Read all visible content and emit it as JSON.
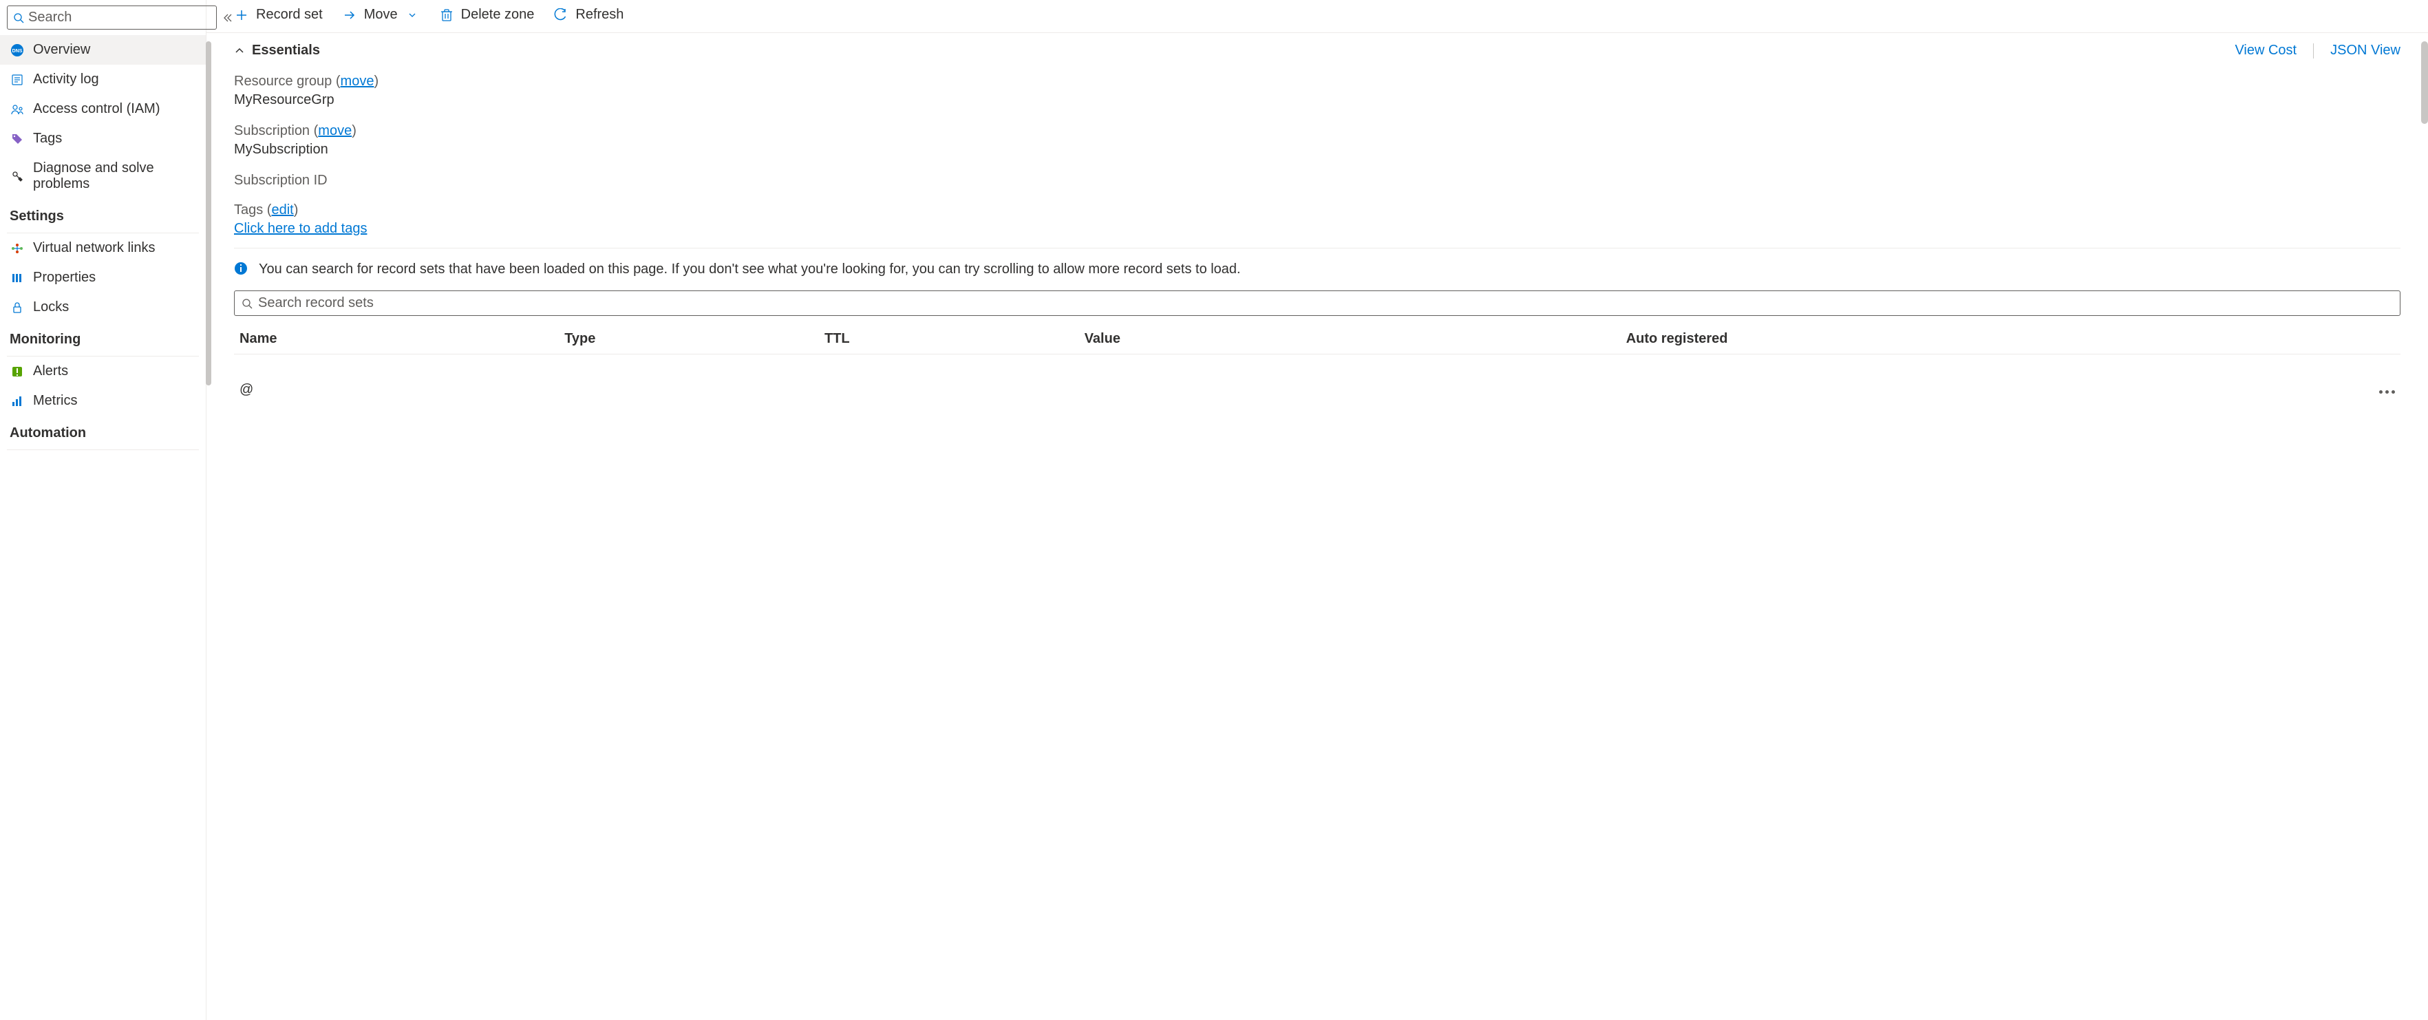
{
  "sidebar": {
    "search_placeholder": "Search",
    "items_top": [
      {
        "label": "Overview",
        "icon": "dns"
      },
      {
        "label": "Activity log",
        "icon": "log"
      },
      {
        "label": "Access control (IAM)",
        "icon": "iam"
      },
      {
        "label": "Tags",
        "icon": "tags"
      },
      {
        "label": "Diagnose and solve problems",
        "icon": "diagnose"
      }
    ],
    "section_settings": "Settings",
    "items_settings": [
      {
        "label": "Virtual network links",
        "icon": "vnet"
      },
      {
        "label": "Properties",
        "icon": "properties"
      },
      {
        "label": "Locks",
        "icon": "locks"
      }
    ],
    "section_monitoring": "Monitoring",
    "items_monitoring": [
      {
        "label": "Alerts",
        "icon": "alerts"
      },
      {
        "label": "Metrics",
        "icon": "metrics"
      }
    ],
    "section_automation": "Automation"
  },
  "toolbar": {
    "record_set": "Record set",
    "move": "Move",
    "delete_zone": "Delete zone",
    "refresh": "Refresh"
  },
  "essentials": {
    "title": "Essentials",
    "view_cost": "View Cost",
    "json_view": "JSON View",
    "resource_group_label": "Resource group",
    "resource_group_move": "move",
    "resource_group_value": "MyResourceGrp",
    "subscription_label": "Subscription",
    "subscription_move": "move",
    "subscription_value": "MySubscription",
    "subscription_id_label": "Subscription ID",
    "subscription_id_value": "",
    "tags_label": "Tags",
    "tags_edit": "edit",
    "tags_add": "Click here to add tags"
  },
  "info": {
    "text": "You can search for record sets that have been loaded on this page. If you don't see what you're looking for, you can try scrolling to allow more record sets to load."
  },
  "records": {
    "search_placeholder": "Search record sets",
    "columns": {
      "name": "Name",
      "type": "Type",
      "ttl": "TTL",
      "value": "Value",
      "auto_registered": "Auto registered"
    },
    "rows": [
      {
        "name": "@",
        "type": "",
        "ttl": "",
        "value": "",
        "auto_registered": ""
      }
    ]
  }
}
